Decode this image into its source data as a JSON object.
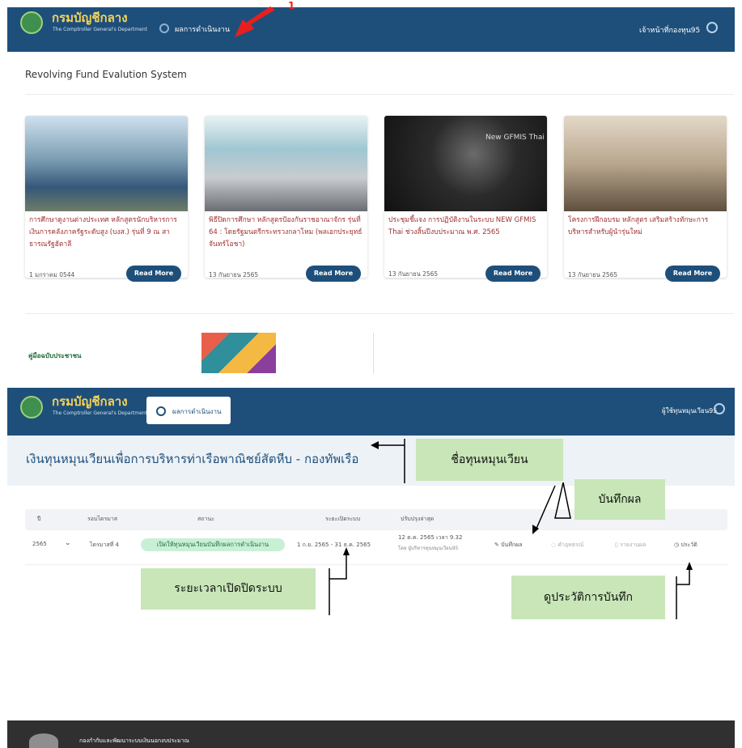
{
  "top": {
    "nav": {
      "brand": "กรมบัญชีกลาง",
      "brand_sub": "The Comptroller General's Department",
      "menu_link": "ผลการดำเนินงาน",
      "user": "เจ้าหน้าที่กองทุน95"
    },
    "annotation_number": "1",
    "system_title": "Revolving Fund Evalution System",
    "cards": [
      {
        "title": "การศึกษาดูงานต่างประเทศ หลักสูตรนักบริหารการเงินการคลังภาครัฐระดับสูง (บงส.) รุ่นที่ 9 ณ สาธารณรัฐฮัตาลี",
        "date": "1 มกราคม 0544",
        "button": "Read More"
      },
      {
        "title": "พิธีปิดการศึกษา หลักสูตรป้องกันราชอาณาจักร รุ่นที่ 64 : โดยรัฐมนตรีกระทรวงกลาโหม (พลเอกประยุทธ์ จันทร์โอชา)",
        "date": "13 กันยายน 2565",
        "button": "Read More"
      },
      {
        "title": "ประชุมชี้แจง การปฏิบัติงานในระบบ NEW GFMIS Thai ช่วงสิ้นปีงบประมาณ พ.ศ. 2565",
        "date": "13 กันยายน 2565",
        "button": "Read More",
        "image_text": "New GFMIS Thai"
      },
      {
        "title": "โครงการฝึกอบรม หลักสูตร เสริมสร้างทักษะการบริหารสำหรับผู้นำรุ่นใหม่",
        "date": "13 กันยายน 2565",
        "button": "Read More"
      }
    ],
    "thumb1_text": "คู่มือฉบับประชาชน"
  },
  "bottom": {
    "nav": {
      "brand": "กรมบัญชีกลาง",
      "brand_sub": "The Comptroller General's Department",
      "tab": "ผลการดำเนินงาน",
      "user": "ผู้ใช้ทุนหมุนเวียน95"
    },
    "fund_title": "เงินทุนหมุนเวียนเพื่อการบริหารท่าเรือพาณิชย์สัตหีบ - กองทัพเรือ",
    "table": {
      "headers": [
        "ปี",
        "รอบไตรมาส",
        "สถานะ",
        "ระยะเปิดระบบ",
        "ปรับปรุงล่าสุด"
      ],
      "row": {
        "year": "2565",
        "quarter": "ไตรมาสที่ 4",
        "status": "เปิดให้ทุนหมุนเวียนบันทึกผลการดำเนินงาน",
        "period": "1 ก.ย. 2565 - 31 ธ.ค. 2565",
        "updated": "12 ต.ค. 2565 เวลา 9.32",
        "updated_by": "โดย ผู้บริหารทุนหมุนเวียน95",
        "actions": [
          "บันทึกผล",
          "คำอุทธรณ์",
          "รายงานผล",
          "ประวัติ"
        ]
      }
    },
    "callouts": {
      "fund_name": "ชื่อทุนหมุนเวียน",
      "record": "บันทึกผล",
      "period": "ระยะเวลาเปิดปิดระบบ",
      "history": "ดูประวัติการบันทึก"
    },
    "footer": "กองกำกับและพัฒนาระบบเงินนอกงบประมาณ"
  },
  "colors": {
    "nav": "#1e4f7a",
    "brand": "#f5d35a",
    "button": "#1e4f7a",
    "status_green": "#c9f0d5",
    "callout": "#c8e6b7",
    "footer": "#303030",
    "annotation_red": "#e81f1f"
  }
}
